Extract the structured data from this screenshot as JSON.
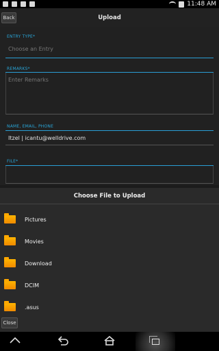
{
  "status_bar": {
    "time": "11:48 AM",
    "icons": [
      "image-icon",
      "bag-icon",
      "lock-icon",
      "briefcase-icon",
      "wifi-icon",
      "battery-icon"
    ]
  },
  "header": {
    "back_label": "Back",
    "title": "Upload"
  },
  "form": {
    "entry_type_label": "ENTRY TYPE*",
    "entry_type_placeholder": "Choose an Entry",
    "remarks_label": "REMARKS*",
    "remarks_placeholder": "Enter Remarks",
    "contact_label": "NAME, EMAIL, PHONE",
    "contact_value": "Itzel | icantu@welldrive.com",
    "file_label": "FILE*"
  },
  "dialog": {
    "title": "Choose File to Upload",
    "items": [
      {
        "label": "Pictures"
      },
      {
        "label": "Movies"
      },
      {
        "label": "Download"
      },
      {
        "label": "DCIM"
      },
      {
        "label": ".asus"
      }
    ],
    "close_label": "Close"
  },
  "navbar": {
    "icons": [
      "up-chevron-icon",
      "back-arrow-icon",
      "home-icon",
      "recent-apps-icon"
    ]
  },
  "colors": {
    "accent": "#29a6d9",
    "folder": "#f7a000"
  }
}
